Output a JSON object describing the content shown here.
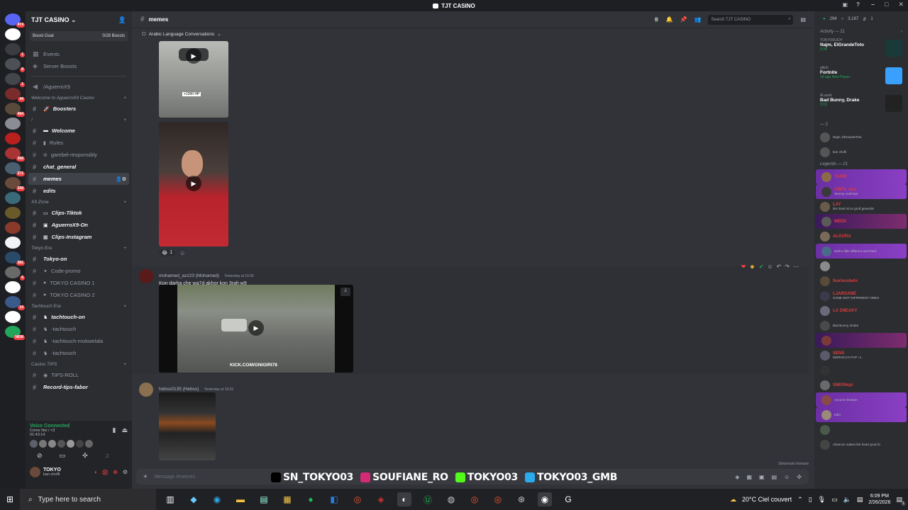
{
  "window": {
    "title": "TJT CASINO"
  },
  "servers": [
    {
      "badge": "474",
      "color": "#5865f2"
    },
    {
      "badge": "",
      "color": "#fff"
    },
    {
      "badge": "1",
      "color": "#3a3c41"
    },
    {
      "badge": "8",
      "color": "#4e5058"
    },
    {
      "badge": "1",
      "color": "#43464b"
    },
    {
      "badge": "44",
      "color": "#7a2c2c"
    },
    {
      "badge": "464",
      "color": "#5a4a3a"
    },
    {
      "badge": "",
      "color": "#8a8e94"
    },
    {
      "badge": "",
      "color": "#b82020"
    },
    {
      "badge": "368",
      "color": "#a33"
    },
    {
      "badge": "271",
      "color": "#4a6070"
    },
    {
      "badge": "349",
      "color": "#6a4a3a"
    },
    {
      "badge": "",
      "color": "#3a6a7a"
    },
    {
      "badge": "",
      "color": "#6a5a2a"
    },
    {
      "badge": "",
      "color": "#8a3a2a"
    },
    {
      "badge": "",
      "color": "#f2f3f5"
    },
    {
      "badge": "381",
      "color": "#2a4a6a"
    },
    {
      "badge": "6",
      "color": "#6a6a6a"
    },
    {
      "badge": "",
      "color": "#fff"
    },
    {
      "badge": "14",
      "color": "#3a5a8a"
    },
    {
      "badge": "",
      "color": "#fff"
    },
    {
      "badge": "NEW",
      "color": "#23a55a"
    }
  ],
  "sidebar": {
    "server_name": "TJT CASINO",
    "boost_label": "Boost Goal",
    "boost_value": "0/28 Boosts",
    "top_items": [
      {
        "label": "Events",
        "icon": "calendar-icon"
      },
      {
        "label": "Server Boosts",
        "icon": "boost-icon"
      }
    ],
    "agu_channel": "/AguerroX9",
    "categories": [
      {
        "name": "Welcome to AguerroX9 Casino",
        "channels": [
          {
            "label": "Boosters",
            "bold": true,
            "icon": "rocket"
          }
        ]
      },
      {
        "name": "!",
        "channels": [
          {
            "label": "Welcome",
            "bold": true,
            "icon": "flag"
          },
          {
            "label": "Rules",
            "bold": false,
            "icon": "scroll"
          },
          {
            "label": "gambel-responsibly",
            "bold": false,
            "icon": "no"
          },
          {
            "label": "chat_general",
            "bold": true,
            "icon": ""
          },
          {
            "label": "memes",
            "bold": true,
            "active": true,
            "icon": ""
          },
          {
            "label": "edits",
            "bold": true,
            "icon": ""
          }
        ]
      },
      {
        "name": "X9 Zone",
        "channels": [
          {
            "label": "Clips-Tiktok",
            "bold": true,
            "icon": "tv"
          },
          {
            "label": "AguerroX9-On",
            "bold": true,
            "icon": "live"
          },
          {
            "label": "Clips-Instagram",
            "bold": true,
            "icon": "cam"
          }
        ]
      },
      {
        "name": "Tokyo Era",
        "channels": [
          {
            "label": "Tokyo-on",
            "bold": true,
            "icon": ""
          },
          {
            "label": "Code-promo",
            "bold": false,
            "icon": "sparkle"
          },
          {
            "label": "TOKYO CASINO 1",
            "bold": false,
            "icon": "coin"
          },
          {
            "label": "TOKYO CASINO 2",
            "bold": false,
            "icon": "coin"
          }
        ]
      },
      {
        "name": "Tachtouch Era",
        "channels": [
          {
            "label": "tachtouch-on",
            "bold": true,
            "icon": "horse"
          },
          {
            "label": "-tachtouch",
            "bold": false,
            "icon": "horse"
          },
          {
            "label": "-tachtouch-mokwelala",
            "bold": false,
            "icon": "horse"
          },
          {
            "label": "-tachtouch",
            "bold": false,
            "icon": "horse"
          }
        ]
      },
      {
        "name": "Casino TIPS",
        "channels": [
          {
            "label": "TIPS-ROLL",
            "bold": false,
            "icon": "dice"
          },
          {
            "label": "Record-tips-fabor",
            "bold": true,
            "icon": ""
          }
        ]
      }
    ],
    "voice": {
      "status": "Voice Connected",
      "channel": "Come Noi / <3",
      "timer": "01:43:14"
    },
    "me": {
      "name": "TOKYO",
      "status": "kan chofli"
    }
  },
  "header": {
    "channel": "memes",
    "thread": "Arabic Language Conversations",
    "search_placeholder": "Search TJT CASINO"
  },
  "messages": [
    {
      "user": "mohamed_azz23 (Mohamed)",
      "time": "Yesterday at 19:30",
      "text": "Kon darha che wa7d akhor kon 3rah w9",
      "overlay": "KICK.COM/ONIGIRI78"
    },
    {
      "user": "hebss0135 (Hebss)",
      "time": "Yesterday at 19:31",
      "text": ""
    }
  ],
  "reaction": {
    "count": "1"
  },
  "first_media_label": "+1000 HP",
  "composer": {
    "placeholder": "Message #memes",
    "slowmode": "Slowmode Immune"
  },
  "members": {
    "counts": {
      "online": "294",
      "total": "3,167",
      "other": "1"
    },
    "activity_header": "Activity — 21",
    "activities": [
      {
        "name": "Najm, ElGrandeToto",
        "sub": "0:34",
        "user": "TOKYO0UCH",
        "color": "#1a3a3a"
      },
      {
        "name": "Fortnite",
        "sub": "2d ago  New Player",
        "user": "glitch",
        "color": "#3aa0ff"
      },
      {
        "name": "Bad Bunny, Drake",
        "sub": "0:19",
        "user": "Al.azeb",
        "color": "#222"
      }
    ],
    "group2_header": "— 2",
    "group2": [
      {
        "name": "",
        "sub": "Najm, ElGrandeToto"
      },
      {
        "name": "",
        "sub": "kan chofli"
      }
    ],
    "legends_header": "Legends — 21",
    "legends": [
      {
        "name": "TAPIR",
        "sub": "",
        "color": "#e03b3b",
        "hl": true
      },
      {
        "name": "CMFlr_dos",
        "sub": "Stormy, Karlman",
        "color": "#e03b3b",
        "hl": true
      },
      {
        "name": "LAY",
        "sub": "Der Esel ist so groß geworde",
        "color": "#e03b3b",
        "hl": false
      },
      {
        "name": "MEEK",
        "sub": "",
        "color": "#e03b3b",
        "hl": "2"
      },
      {
        "name": "ALGURA",
        "sub": "",
        "color": "#e03b3b",
        "hl": false
      },
      {
        "name": "",
        "sub": "Built a little different and that's",
        "color": "#e03b3b",
        "hl": true
      },
      {
        "name": "",
        "sub": "",
        "color": "#e03b3b",
        "hl": false
      },
      {
        "name": "fearlessbets",
        "sub": "",
        "color": "#e03b3b",
        "hl": false
      },
      {
        "name": "LJARGANE",
        "sub": "SAME SHIT DIFFERENT VIBES",
        "color": "#e03b3b",
        "hl": false
      },
      {
        "name": "LA SNEAKY",
        "sub": "",
        "color": "#e03b3b",
        "hl": false
      },
      {
        "name": "",
        "sub": "Bad Bunny, Drake",
        "color": "#e03b3b",
        "hl": false
      },
      {
        "name": "",
        "sub": "",
        "color": "#e03b3b",
        "hl": "2"
      },
      {
        "name": "SENS",
        "sub": "MOROCCO PVP +1",
        "color": "#e03b3b",
        "hl": false
      },
      {
        "name": "",
        "sub": "",
        "color": "#e03b3b",
        "hl": false
      },
      {
        "name": "SIMONxpi",
        "sub": "",
        "color": "#e03b3b",
        "hl": false
      },
      {
        "name": "",
        "sub": "Aucune émotion",
        "color": "#e03b3b",
        "hl": true
      },
      {
        "name": "",
        "sub": "hdm",
        "color": "#e03b3b",
        "hl": true
      },
      {
        "name": "",
        "sub": "",
        "color": "#e03b3b",
        "hl": false
      },
      {
        "name": "",
        "sub": "Absence makes the heart grow fo",
        "color": "#e03b3b",
        "hl": false
      }
    ]
  },
  "social_overlay": [
    {
      "icon": "tiktok-icon",
      "label": "SN_TOKYO03",
      "color": "#000"
    },
    {
      "icon": "instagram-icon",
      "label": "SOUFIANE_RO",
      "color": "#d62976"
    },
    {
      "icon": "kick-icon",
      "label": "TOKYO03",
      "color": "#53fc18"
    },
    {
      "icon": "telegram-icon",
      "label": "TOKYO03_GMB",
      "color": "#2aabee"
    }
  ],
  "taskbar": {
    "search_placeholder": "Type here to search",
    "weather": "20°C  Ciel couvert",
    "time": "6:09 PM",
    "date": "2/26/2026",
    "notif": "1"
  }
}
